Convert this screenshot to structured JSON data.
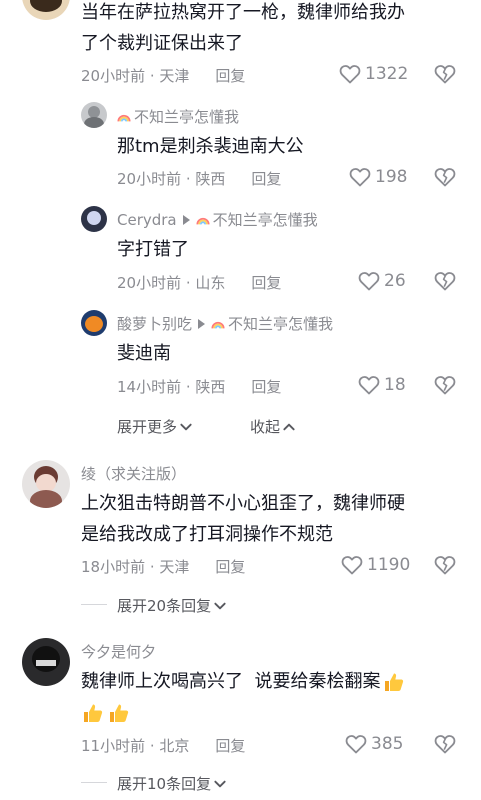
{
  "comments": [
    {
      "text_lines": [
        "当年在萨拉热窝开了一枪，魏律师给我办",
        "了个裁判证保出来了"
      ],
      "time_location": "20小时前 · 天津",
      "reply_label": "回复",
      "likes": "1322"
    },
    {
      "author": "不知兰亭怎懂我",
      "text": "那tm是刺杀裴迪南大公",
      "time_location": "20小时前 · 陕西",
      "reply_label": "回复",
      "likes": "198"
    },
    {
      "author": "Cerydra",
      "reply_to": "不知兰亭怎懂我",
      "text": "字打错了",
      "time_location": "20小时前 · 山东",
      "reply_label": "回复",
      "likes": "26"
    },
    {
      "author": "酸萝卜别吃",
      "reply_to": "不知兰亭怎懂我",
      "text": "斐迪南",
      "time_location": "14小时前 · 陕西",
      "reply_label": "回复",
      "likes": "18"
    },
    {
      "author": "绫（求关注版）",
      "text_lines": [
        "上次狙击特朗普不小心狙歪了，魏律师硬",
        "是给我改成了打耳洞操作不规范"
      ],
      "time_location": "18小时前 · 天津",
      "reply_label": "回复",
      "likes": "1190"
    },
    {
      "author": "今夕是何夕",
      "text_lines": [
        "魏律师上次喝高兴了  说要给秦桧翻案"
      ],
      "time_location": "11小时前 · 北京",
      "reply_label": "回复",
      "likes": "385"
    }
  ],
  "expand_more": "展开更多",
  "collapse": "收起",
  "expand_replies_1": "展开20条回复",
  "expand_replies_2": "展开10条回复",
  "icons": {
    "like": "heart-icon",
    "dislike": "broken-heart-icon",
    "thumb": "thumbs-up-emoji",
    "rainbow": "rainbow-icon"
  },
  "colors": {
    "text": "#161823",
    "meta": "#8a8b91",
    "thumb": "#ffc83d"
  }
}
